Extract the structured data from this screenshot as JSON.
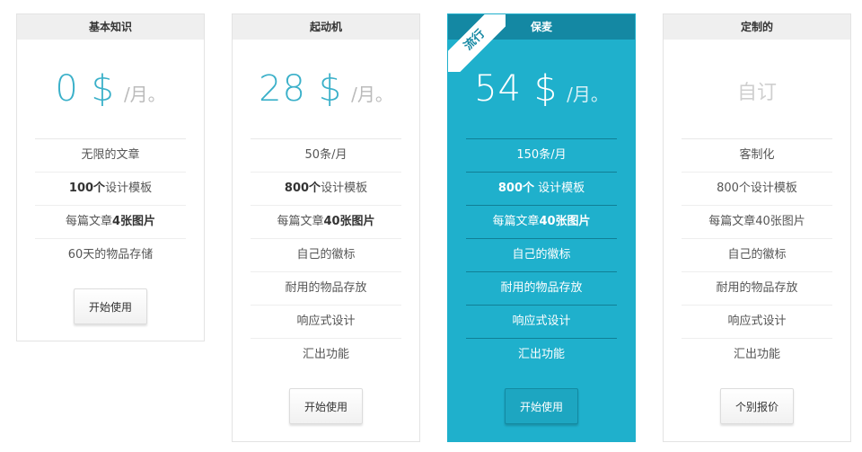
{
  "plans": [
    {
      "name": "基本知识",
      "amount": "0 $",
      "per": "/月。",
      "features": [
        {
          "pre": "",
          "strong": "",
          "post": "无限的文章"
        },
        {
          "pre": "",
          "strong": "100个",
          "post": "设计模板"
        },
        {
          "pre": "每篇文章",
          "strong": "4张图片",
          "post": ""
        },
        {
          "pre": "",
          "strong": "",
          "post": "60天的物品存储"
        }
      ],
      "cta": "开始使用"
    },
    {
      "name": "起动机",
      "amount": "28 $",
      "per": "/月。",
      "features": [
        {
          "pre": "",
          "strong": "",
          "post": "50条/月"
        },
        {
          "pre": "",
          "strong": "800个",
          "post": "设计模板"
        },
        {
          "pre": "每篇文章",
          "strong": "40张图片",
          "post": ""
        },
        {
          "pre": "",
          "strong": "",
          "post": "自己的徽标"
        },
        {
          "pre": "",
          "strong": "",
          "post": "耐用的物品存放"
        },
        {
          "pre": "",
          "strong": "",
          "post": "响应式设计"
        },
        {
          "pre": "",
          "strong": "",
          "post": "汇出功能"
        }
      ],
      "cta": "开始使用"
    },
    {
      "name": "保麦",
      "ribbon": "流行",
      "amount": "54 $",
      "per": "/月。",
      "features": [
        {
          "pre": "",
          "strong": "",
          "post": "150条/月"
        },
        {
          "pre": "",
          "strong": "800个",
          "post": " 设计模板"
        },
        {
          "pre": "每篇文章",
          "strong": "40张图片",
          "post": ""
        },
        {
          "pre": "",
          "strong": "",
          "post": "自己的徽标"
        },
        {
          "pre": "",
          "strong": "",
          "post": "耐用的物品存放"
        },
        {
          "pre": "",
          "strong": "",
          "post": "响应式设计"
        },
        {
          "pre": "",
          "strong": "",
          "post": "汇出功能"
        }
      ],
      "cta": "开始使用"
    },
    {
      "name": "定制的",
      "custom": "自订",
      "features": [
        {
          "pre": "",
          "strong": "",
          "post": "客制化"
        },
        {
          "pre": "",
          "strong": "",
          "post": "800个设计模板"
        },
        {
          "pre": "",
          "strong": "",
          "post": "每篇文章40张图片"
        },
        {
          "pre": "",
          "strong": "",
          "post": "自己的徽标"
        },
        {
          "pre": "",
          "strong": "",
          "post": "耐用的物品存放"
        },
        {
          "pre": "",
          "strong": "",
          "post": "响应式设计"
        },
        {
          "pre": "",
          "strong": "",
          "post": "汇出功能"
        }
      ],
      "cta": "个别报价"
    }
  ],
  "colors": {
    "accent": "#1fb0cc",
    "accent_dark": "#1488a3",
    "price_text": "#3ab0c9",
    "header_bg": "#efefef"
  }
}
